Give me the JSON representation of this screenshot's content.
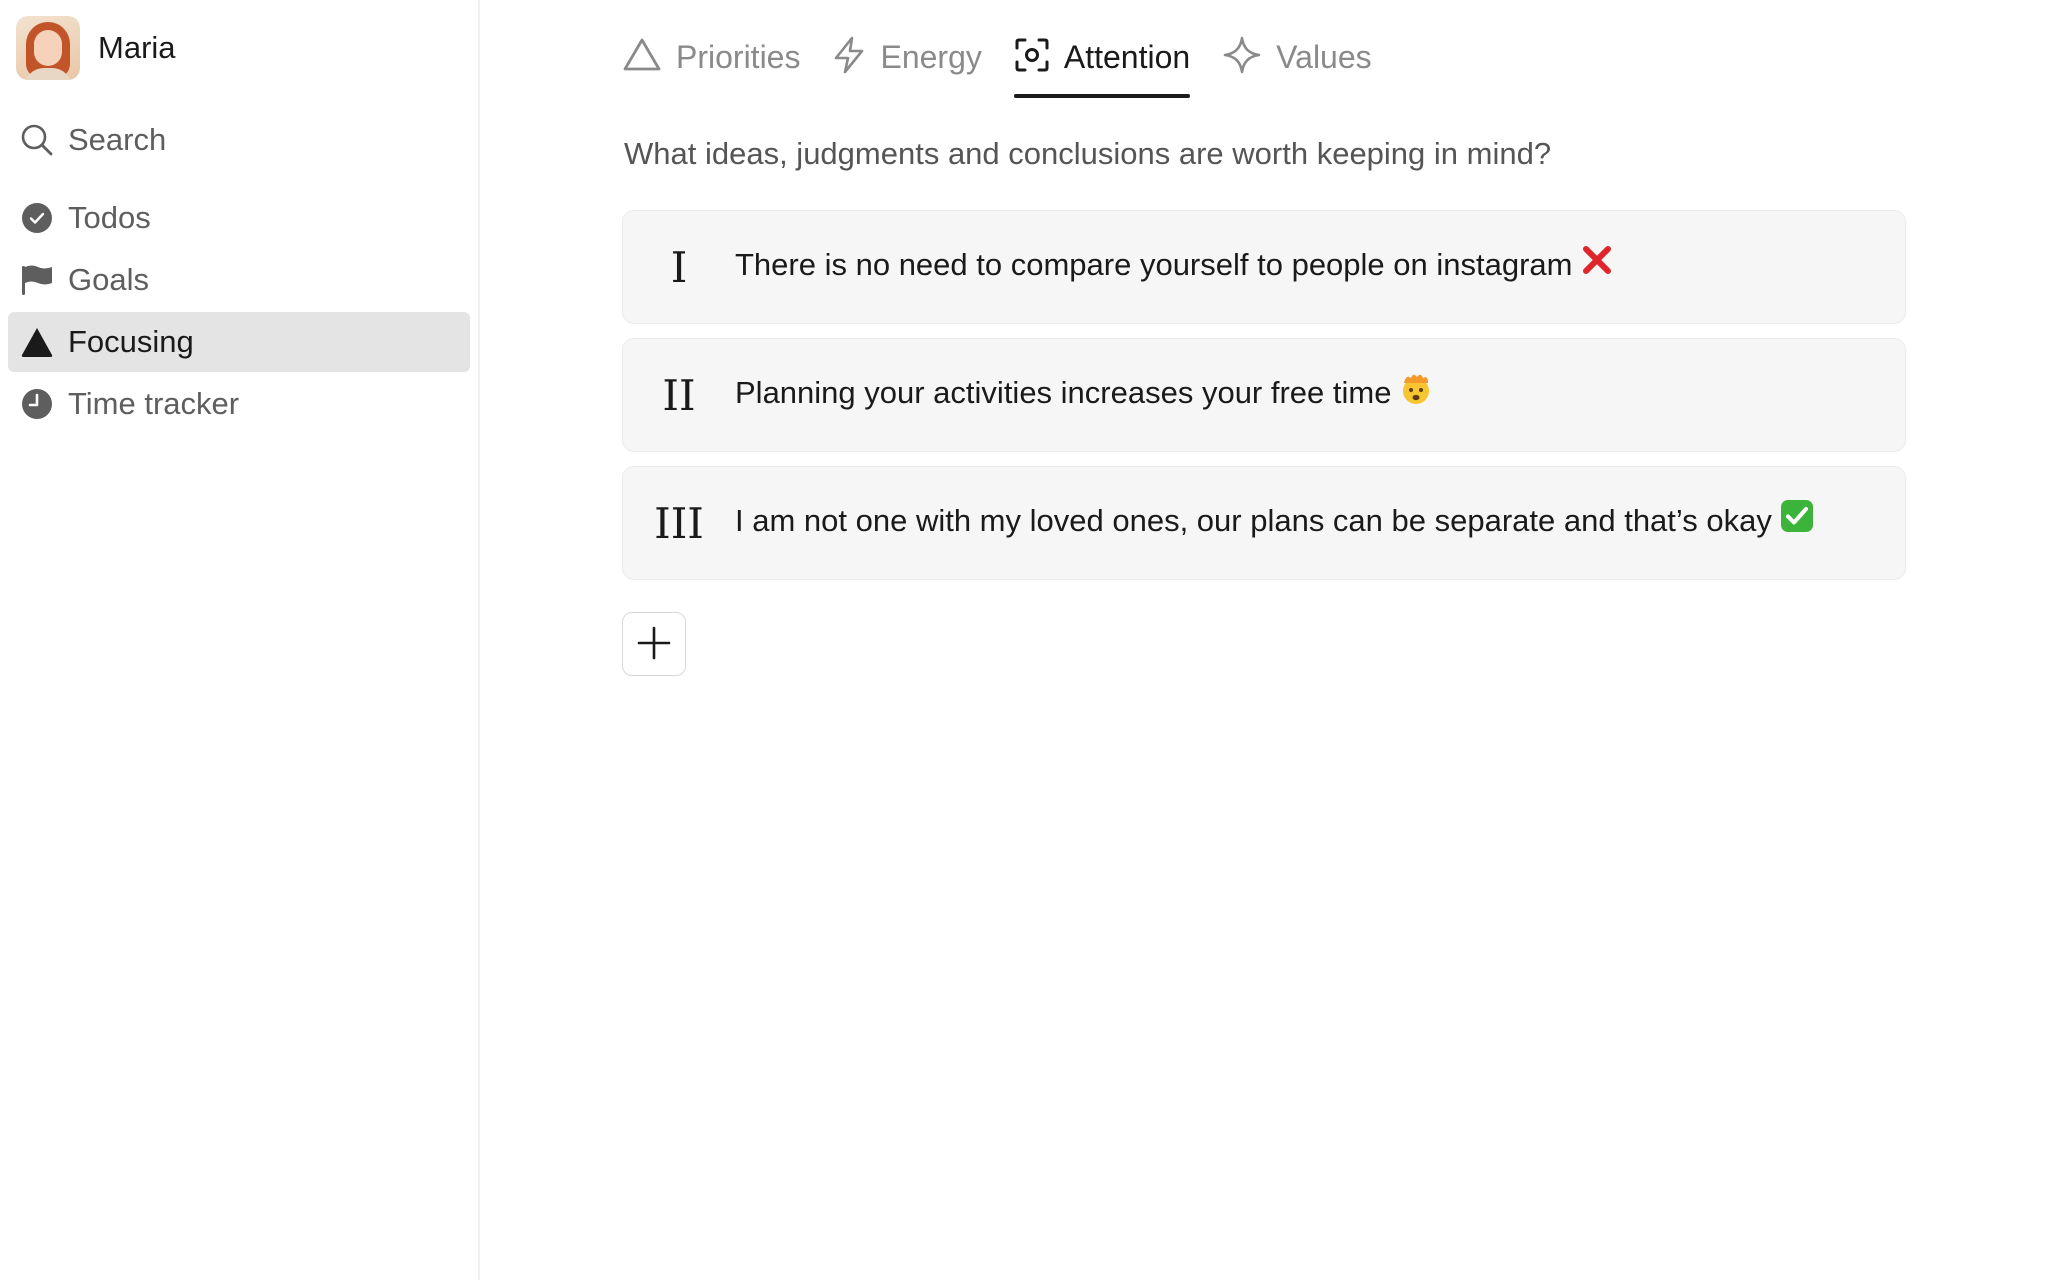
{
  "user": {
    "name": "Maria"
  },
  "search": {
    "label": "Search"
  },
  "sidebar": {
    "items": [
      {
        "label": "Todos",
        "icon": "check-circle-icon",
        "active": false
      },
      {
        "label": "Goals",
        "icon": "flag-icon",
        "active": false
      },
      {
        "label": "Focusing",
        "icon": "triangle-icon",
        "active": true
      },
      {
        "label": "Time tracker",
        "icon": "clock-icon",
        "active": false
      }
    ]
  },
  "tabs": [
    {
      "label": "Priorities",
      "icon": "triangle-outline-icon",
      "active": false
    },
    {
      "label": "Energy",
      "icon": "lightning-icon",
      "active": false
    },
    {
      "label": "Attention",
      "icon": "focus-target-icon",
      "active": true
    },
    {
      "label": "Values",
      "icon": "sparkle-icon",
      "active": false
    }
  ],
  "main": {
    "question": "What ideas, judgments and conclusions are worth keeping in mind?",
    "items": [
      {
        "numeral": "I",
        "text": "There is no need to compare yourself to people on instagram",
        "emoji": "cross-mark-emoji"
      },
      {
        "numeral": "II",
        "text": "Planning your activities increases your free time",
        "emoji": "mind-blown-emoji"
      },
      {
        "numeral": "III",
        "text": "I am not one with my loved ones, our plans can be separate and that’s okay",
        "emoji": "check-mark-emoji"
      }
    ]
  },
  "colors": {
    "active_nav_bg": "#e4e4e4",
    "card_bg": "#f6f6f6",
    "text_primary": "#1a1a1a",
    "text_secondary": "#5e5e5e",
    "tab_inactive": "#8a8a8a",
    "cross_red": "#e0262d",
    "check_green": "#3cb43c"
  }
}
